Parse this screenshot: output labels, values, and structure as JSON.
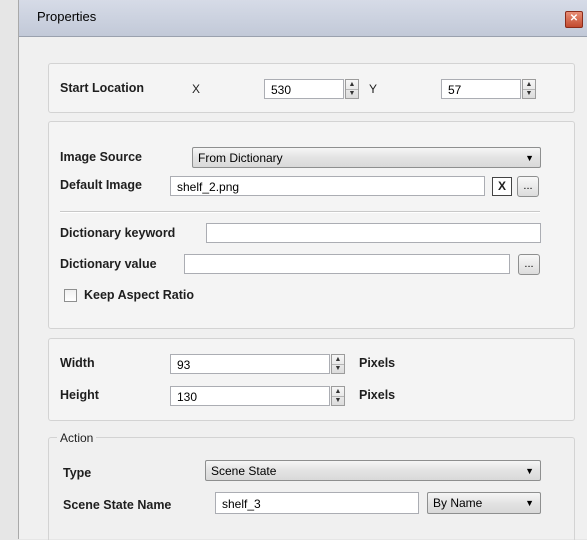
{
  "window": {
    "title": "Properties",
    "close_icon": "close-icon",
    "colors": {
      "titlebar": "#c7cddb",
      "close": "#c9553a",
      "panel_bg": "#f4f4f4"
    }
  },
  "start_location": {
    "label": "Start Location",
    "x_label": "X",
    "x_value": "530",
    "y_label": "Y",
    "y_value": "57"
  },
  "image_section": {
    "source_label": "Image Source",
    "source_value": "From Dictionary",
    "default_image_label": "Default Image",
    "default_image_value": "shelf_2.png",
    "clear_button_label": "X",
    "browse_button_label": "...",
    "dict_keyword_label": "Dictionary keyword",
    "dict_keyword_value": "",
    "dict_value_label": "Dictionary value",
    "dict_value_value": "",
    "dict_value_browse_label": "...",
    "keep_aspect_label": "Keep Aspect Ratio",
    "keep_aspect_checked": false
  },
  "size": {
    "width_label": "Width",
    "width_value": "93",
    "width_unit": "Pixels",
    "height_label": "Height",
    "height_value": "130",
    "height_unit": "Pixels"
  },
  "action": {
    "group_label": "Action",
    "type_label": "Type",
    "type_value": "Scene State",
    "scene_state_name_label": "Scene State Name",
    "scene_state_name_value": "shelf_3",
    "by_mode_value": "By Name"
  }
}
